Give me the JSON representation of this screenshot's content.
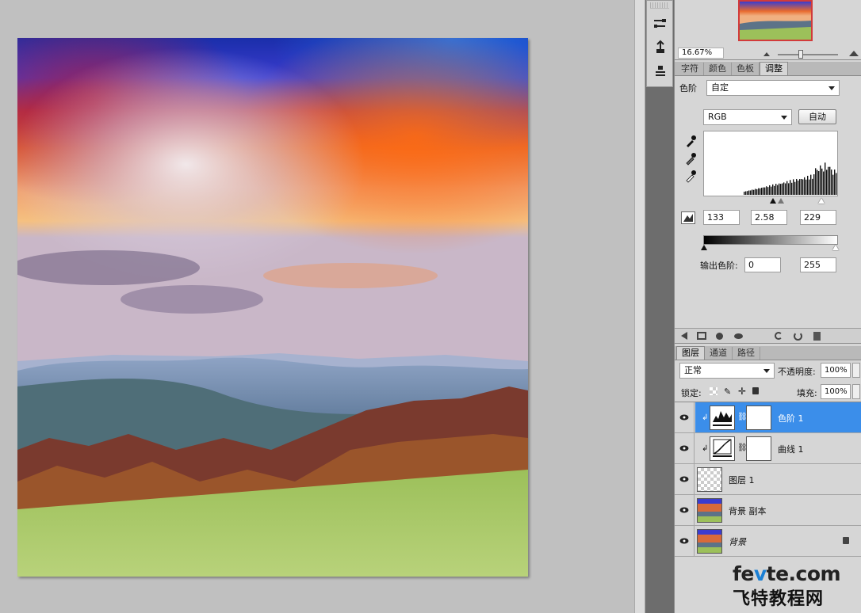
{
  "navigator": {
    "zoom": "16.67%"
  },
  "panel_tabs": {
    "items": [
      {
        "label": "字符"
      },
      {
        "label": "颜色"
      },
      {
        "label": "色板"
      },
      {
        "label": "调整"
      }
    ],
    "active_index": 3
  },
  "levels": {
    "title_label": "色阶",
    "preset": "自定",
    "channel": "RGB",
    "auto_label": "自动",
    "input_black": "133",
    "input_gamma": "2.58",
    "input_white": "229",
    "output_label": "输出色阶:",
    "output_black": "0",
    "output_white": "255"
  },
  "layers_tabs": {
    "items": [
      {
        "label": "图层"
      },
      {
        "label": "通道"
      },
      {
        "label": "路径"
      }
    ],
    "active_index": 0
  },
  "layers_panel": {
    "blend_mode": "正常",
    "opacity_label": "不透明度:",
    "opacity_value": "100%",
    "lock_label": "锁定:",
    "fill_label": "填充:",
    "fill_value": "100%",
    "layers": [
      {
        "name": "色阶 1",
        "selected": true
      },
      {
        "name": "曲线 1",
        "selected": false
      },
      {
        "name": "图层 1",
        "selected": false
      },
      {
        "name": "背景 副本",
        "selected": false
      },
      {
        "name": "背景",
        "selected": false
      }
    ]
  },
  "watermark": {
    "line1_a": "fe",
    "line1_b": "v",
    "line1_c": "te.com",
    "line2": "飞特教程网"
  },
  "colors": {
    "selected_layer": "#3b8eea",
    "panel_bg": "#d6d6d6",
    "canvas_bg": "#c0c0c0",
    "tool_column": "#6d6d6d"
  }
}
